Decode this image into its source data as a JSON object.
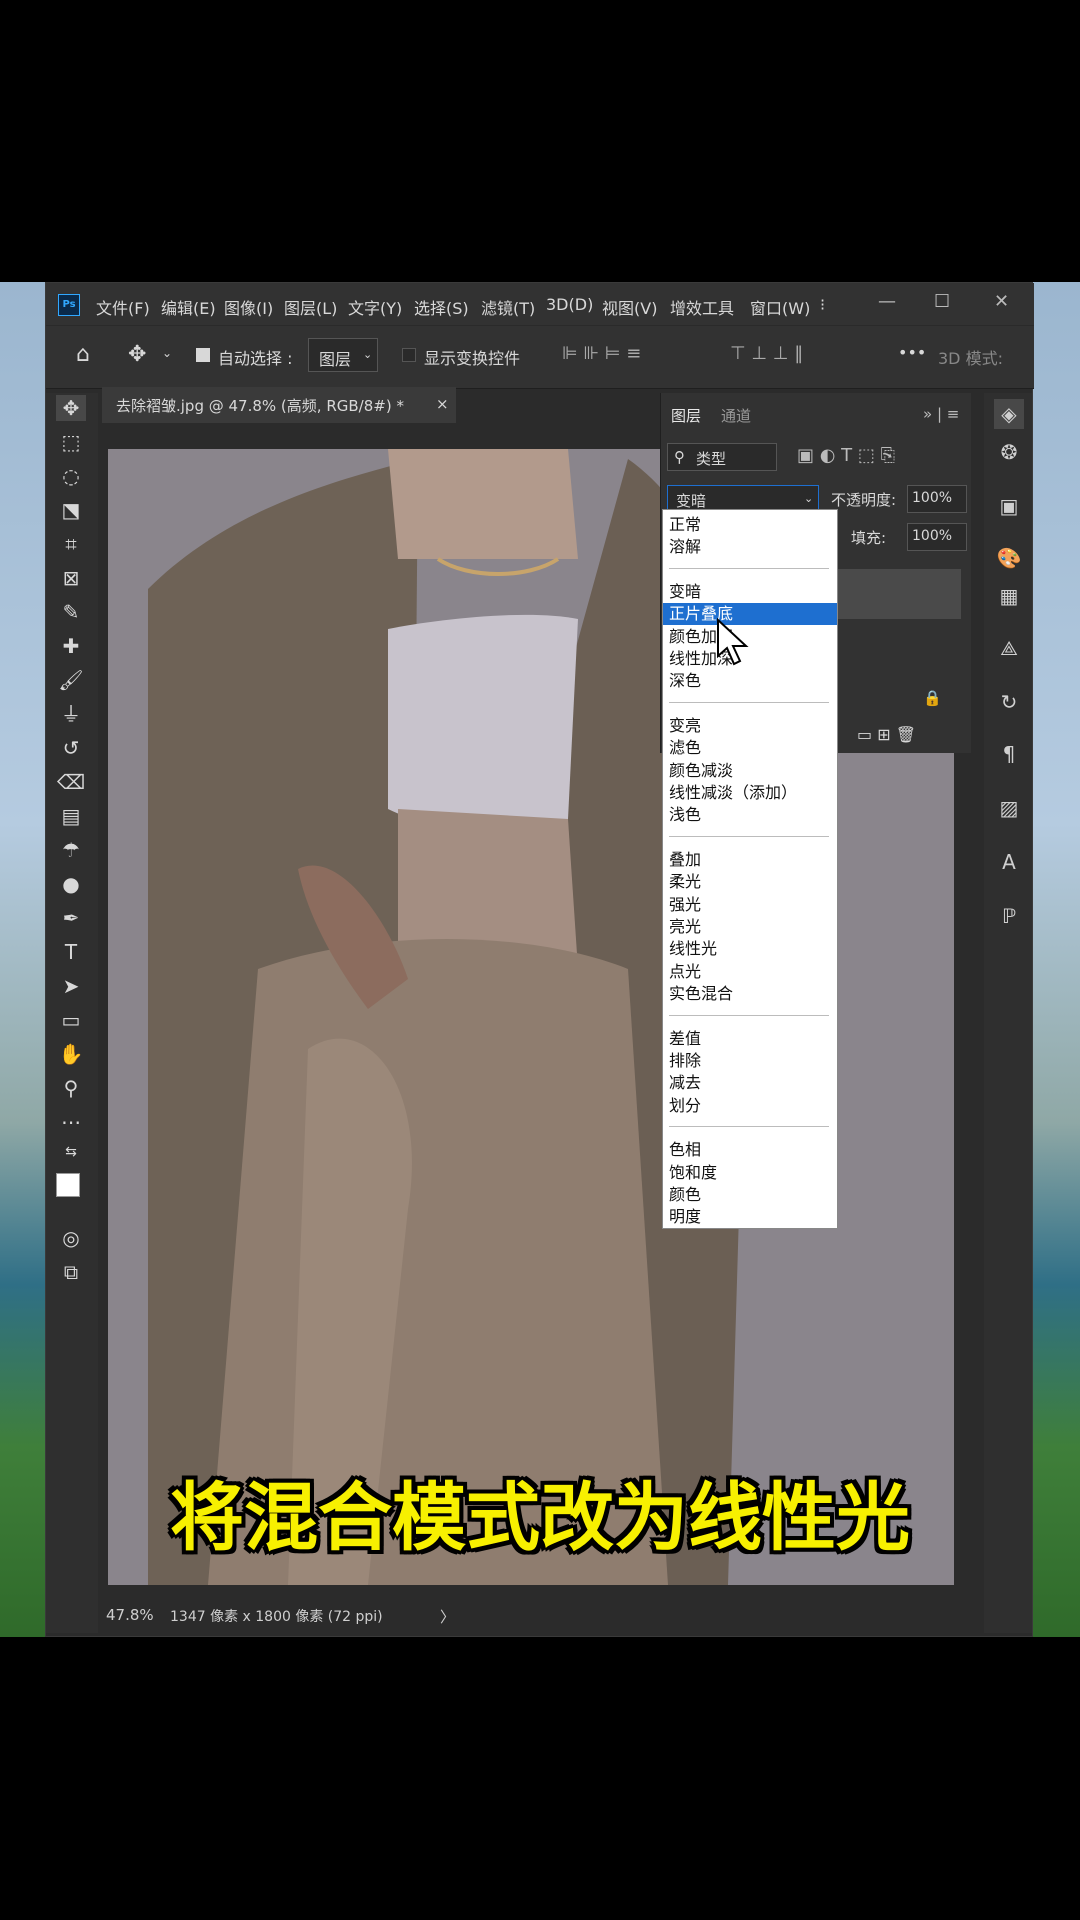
{
  "menubar": {
    "logo": "Ps",
    "items": [
      "文件(F)",
      "编辑(E)",
      "图像(I)",
      "图层(L)",
      "文字(Y)",
      "选择(S)",
      "滤镜(T)",
      "3D(D)",
      "视图(V)",
      "增效工具",
      "窗口(W)",
      "⁝"
    ],
    "window_controls": [
      "—",
      "☐",
      "✕"
    ]
  },
  "options": {
    "auto_select_label": "自动选择 :",
    "auto_select_target": "图层",
    "show_transform_label": "显示变换控件",
    "more": "•••",
    "mode_3d": "3D 模式:"
  },
  "doc": {
    "tab_title": "去除褶皱.jpg @ 47.8% (高频, RGB/8#) *",
    "close": "×"
  },
  "status": {
    "zoom": "47.8%",
    "size": "1347 像素 x 1800 像素 (72 ppi)",
    "arrow": "〉"
  },
  "layers_panel": {
    "tabs": [
      "图层",
      "通道"
    ],
    "filter_label": "类型",
    "blend_mode": "变暗",
    "opacity_label": "不透明度:",
    "opacity_value": "100%",
    "fill_label": "填充:",
    "fill_value": "100%"
  },
  "blend_dropdown": {
    "groups": [
      [
        "正常",
        "溶解"
      ],
      [
        "变暗",
        "正片叠底",
        "颜色加深",
        "线性加深",
        "深色"
      ],
      [
        "变亮",
        "滤色",
        "颜色减淡",
        "线性减淡（添加）",
        "浅色"
      ],
      [
        "叠加",
        "柔光",
        "强光",
        "亮光",
        "线性光",
        "点光",
        "实色混合"
      ],
      [
        "差值",
        "排除",
        "减去",
        "划分"
      ],
      [
        "色相",
        "饱和度",
        "颜色",
        "明度"
      ]
    ],
    "selected": "正片叠底"
  },
  "caption": "将混合模式改为线性光"
}
